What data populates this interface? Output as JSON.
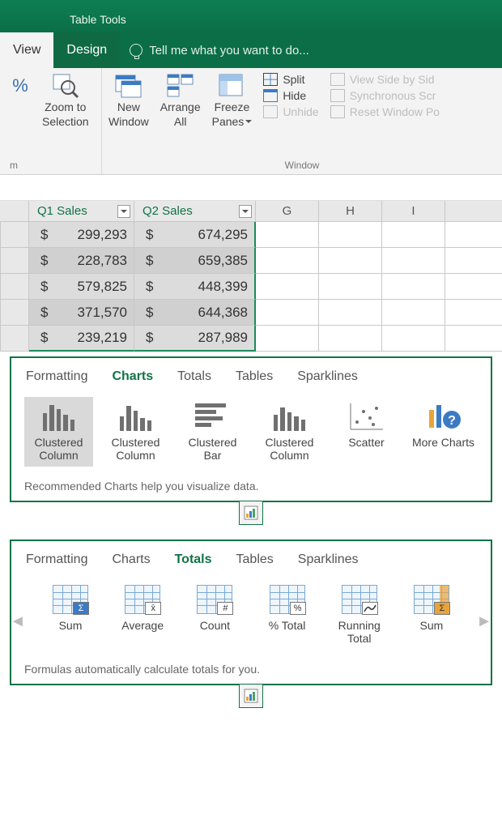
{
  "title": {
    "context": "Table Tools"
  },
  "tabs": {
    "view": "View",
    "design": "Design",
    "tellme": "Tell me what you want to do..."
  },
  "ribbon": {
    "pct": "%",
    "zoomsel1": "Zoom to",
    "zoomsel2": "Selection",
    "grouplabel_left": "m",
    "newwin1": "New",
    "newwin2": "Window",
    "arrange1": "Arrange",
    "arrange2": "All",
    "freeze1": "Freeze",
    "freeze2": "Panes",
    "split": "Split",
    "hide": "Hide",
    "unhide": "Unhide",
    "sbs": "View Side by Sid",
    "sync": "Synchronous Scr",
    "reset": "Reset Window Po",
    "grouplabel_window": "Window"
  },
  "columns": {
    "q1": "Q1 Sales",
    "q2": "Q2 Sales",
    "g": "G",
    "h": "H",
    "i": "I"
  },
  "data": [
    {
      "q1": "299,293",
      "q2": "674,295"
    },
    {
      "q1": "228,783",
      "q2": "659,385"
    },
    {
      "q1": "579,825",
      "q2": "448,399"
    },
    {
      "q1": "371,570",
      "q2": "644,368"
    },
    {
      "q1": "239,219",
      "q2": "287,989"
    }
  ],
  "currency": "$",
  "qa": {
    "tabs": {
      "formatting": "Formatting",
      "charts": "Charts",
      "totals": "Totals",
      "tables": "Tables",
      "sparklines": "Sparklines"
    },
    "charts": {
      "opt1": "Clustered Column",
      "opt2": "Clustered Column",
      "opt3": "Clustered Bar",
      "opt4": "Clustered Column",
      "opt5": "Scatter",
      "opt6": "More Charts",
      "footer": "Recommended Charts help you visualize data."
    },
    "totals": {
      "opt1": "Sum",
      "opt2": "Average",
      "opt3": "Count",
      "opt4": "% Total",
      "opt5": "Running Total",
      "opt6": "Sum",
      "sym2": "x̄",
      "sym3": "#",
      "sym4": "%",
      "footer": "Formulas automatically calculate totals for you."
    }
  }
}
